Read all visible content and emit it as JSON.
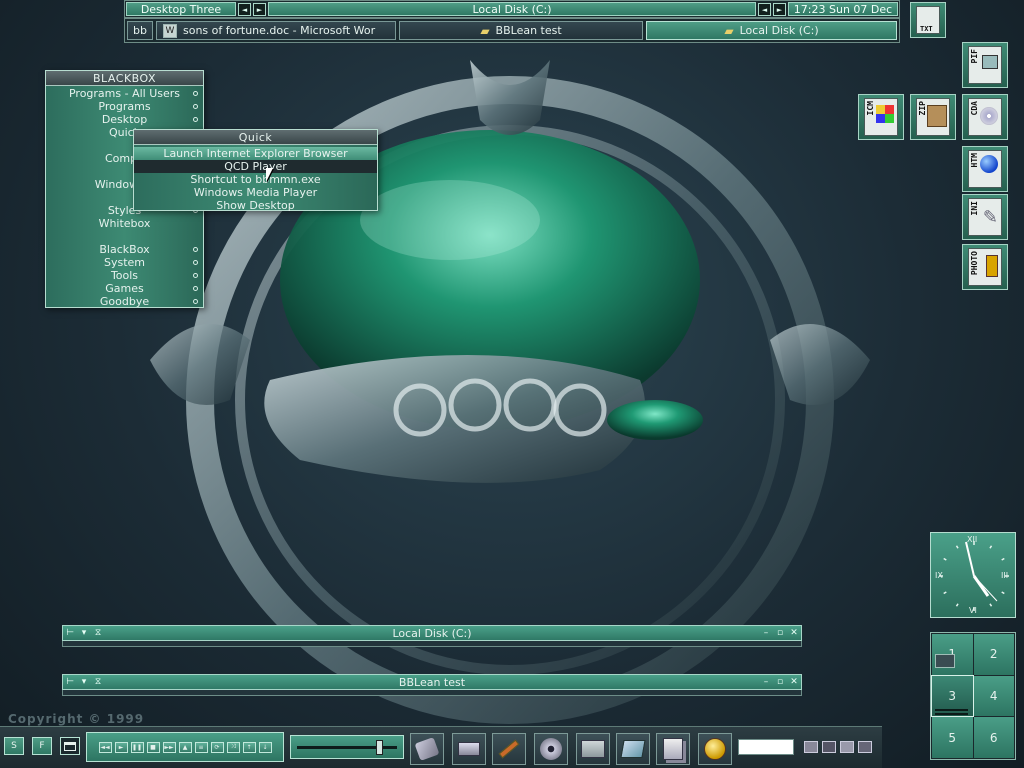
{
  "colors": {
    "accent": "#3d8a73",
    "accent_light": "#6bb9a1",
    "background": "#1c2c36",
    "border": "#a7d3c5"
  },
  "toolbar": {
    "workspace": "Desktop Three",
    "window_title": "Local Disk (C:)",
    "clock": "17:23 Sun 07 Dec",
    "prev_icon": "arrow-left-icon",
    "next_icon": "arrow-right-icon",
    "tasks": [
      {
        "label": "bb",
        "icon": ""
      },
      {
        "label": "sons of fortune.doc - Microsoft Wor",
        "icon": "word-document-icon"
      },
      {
        "label": "BBLean test",
        "icon": "folder-icon"
      },
      {
        "label": "Local Disk (C:)",
        "icon": "folder-icon"
      }
    ]
  },
  "menu": {
    "title": "BLACKBOX",
    "items": [
      "Programs - All Users",
      "Programs",
      "Desktop",
      "Quick",
      "",
      "Compu",
      "",
      "Windows E",
      "",
      "Styles",
      "Whitebox",
      "",
      "BlackBox",
      "System",
      "Tools",
      "Games",
      "Goodbye"
    ]
  },
  "submenu": {
    "title": "Quick",
    "items": [
      "Launch Internet Explorer Browser",
      "QCD Player",
      "Shortcut to bbmmn.exe",
      "Windows Media Player",
      "Show Desktop"
    ]
  },
  "desktop_icons": [
    {
      "ext": "PIF",
      "icon": "pif-file-icon"
    },
    {
      "ext": "ICM",
      "icon": "icm-file-icon"
    },
    {
      "ext": "ZIP",
      "icon": "zip-archive-icon"
    },
    {
      "ext": "CDA",
      "icon": "cd-audio-icon"
    },
    {
      "ext": "HTM",
      "icon": "html-file-icon"
    },
    {
      "ext": "INI",
      "icon": "ini-settings-icon"
    },
    {
      "ext": "PHOTO",
      "icon": "photo-film-icon"
    },
    {
      "ext": "TXT",
      "icon": "text-file-icon"
    }
  ],
  "windows": [
    {
      "title": "Local Disk (C:)"
    },
    {
      "title": "BBLean test"
    }
  ],
  "clock": {
    "numerals": [
      "XII",
      "III",
      "VI",
      "IX"
    ],
    "time": "17:23"
  },
  "pager": {
    "desktops": [
      "1",
      "2",
      "3",
      "4",
      "5",
      "6"
    ],
    "current": 3
  },
  "watermark": {
    "copyright": "Copyright ©  1999"
  },
  "bottombar": {
    "left_buttons": [
      "S",
      "F",
      ""
    ],
    "media_buttons": [
      "rewind",
      "play",
      "pause",
      "stop",
      "fast-forward",
      "eject",
      "playlist",
      "repeat",
      "shuffle",
      "up",
      "down"
    ],
    "volume_level": 0.85,
    "dock_icons": [
      "brush-icon",
      "drive-icon",
      "tools-icon",
      "film-reel-icon",
      "folder-icon",
      "scanner-icon",
      "documents-icon",
      "quicktime-icon"
    ]
  }
}
